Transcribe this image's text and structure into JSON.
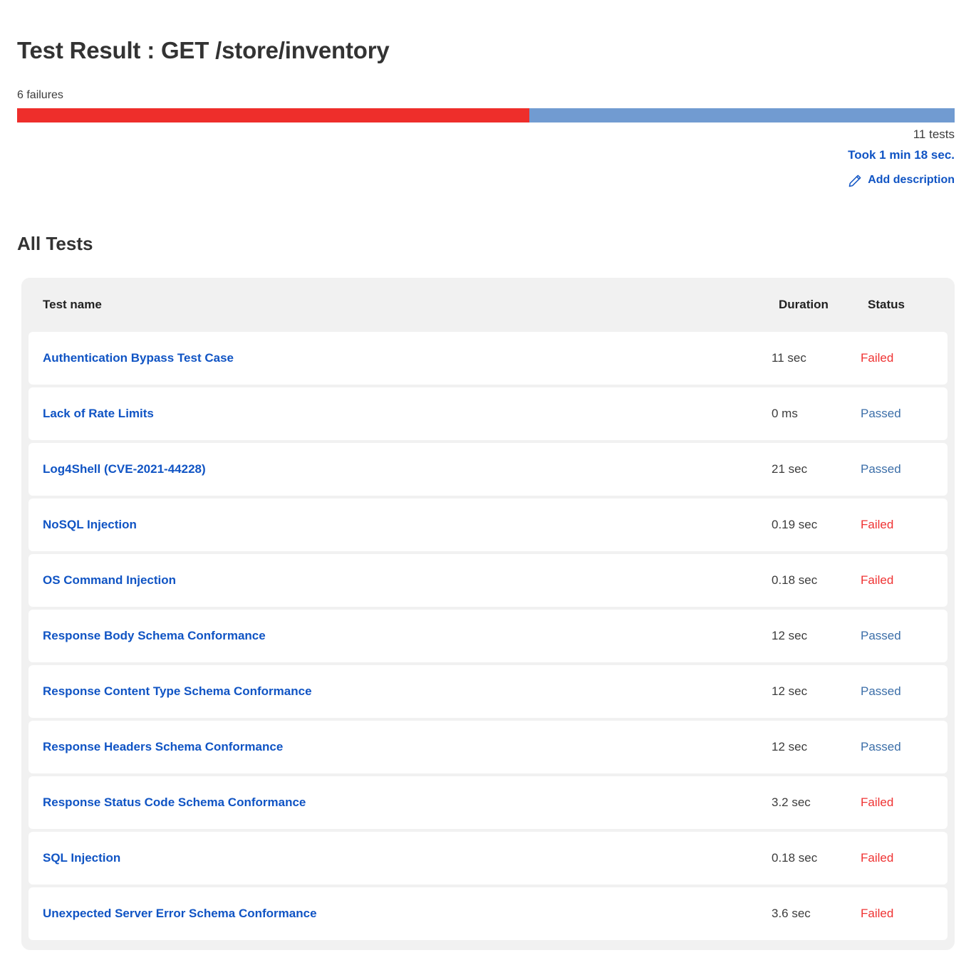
{
  "header": {
    "title": "Test Result : GET /store/inventory"
  },
  "summary": {
    "failures_label": "6 failures",
    "total_tests_label": "11 tests",
    "duration_label": "Took 1 min 18 sec.",
    "add_description_label": "Add description",
    "pencil_icon": "pencil-icon",
    "failed_count": 6,
    "total_count": 11,
    "failed_percent": 54.6,
    "colors": {
      "fail_bar": "#ee2e2b",
      "pass_bar": "#719bd1",
      "link": "#1054c4",
      "failed_text": "#ef3232",
      "passed_text": "#3b6ea8"
    }
  },
  "section": {
    "heading": "All Tests"
  },
  "table": {
    "columns": {
      "name": "Test name",
      "duration": "Duration",
      "status": "Status"
    },
    "rows": [
      {
        "name": "Authentication Bypass Test Case",
        "duration": "11 sec",
        "status": "Failed"
      },
      {
        "name": "Lack of Rate Limits",
        "duration": "0 ms",
        "status": "Passed"
      },
      {
        "name": "Log4Shell (CVE-2021-44228)",
        "duration": "21 sec",
        "status": "Passed"
      },
      {
        "name": "NoSQL Injection",
        "duration": "0.19 sec",
        "status": "Failed"
      },
      {
        "name": "OS Command Injection",
        "duration": "0.18 sec",
        "status": "Failed"
      },
      {
        "name": "Response Body Schema Conformance",
        "duration": "12 sec",
        "status": "Passed"
      },
      {
        "name": "Response Content Type Schema Conformance",
        "duration": "12 sec",
        "status": "Passed"
      },
      {
        "name": "Response Headers Schema Conformance",
        "duration": "12 sec",
        "status": "Passed"
      },
      {
        "name": "Response Status Code Schema Conformance",
        "duration": "3.2 sec",
        "status": "Failed"
      },
      {
        "name": "SQL Injection",
        "duration": "0.18 sec",
        "status": "Failed"
      },
      {
        "name": "Unexpected Server Error Schema Conformance",
        "duration": "3.6 sec",
        "status": "Failed"
      }
    ]
  }
}
